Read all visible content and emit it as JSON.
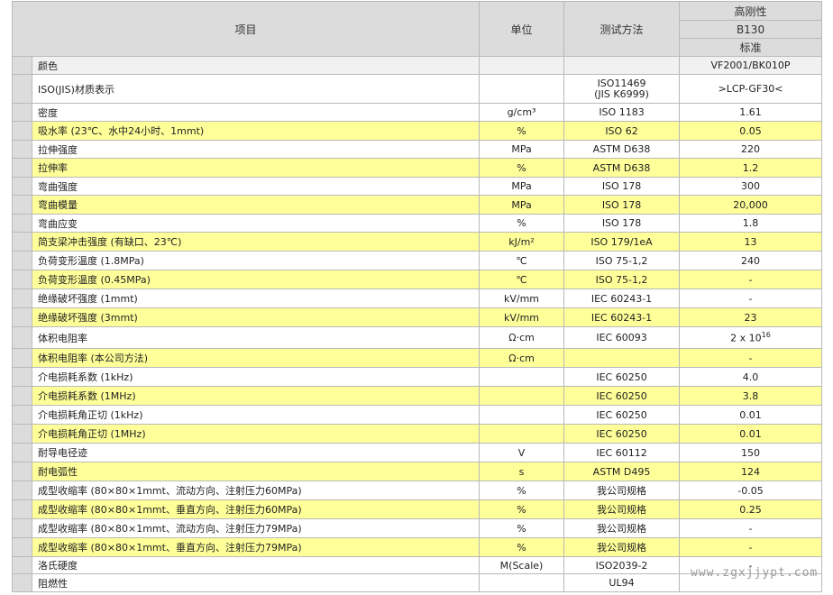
{
  "header": {
    "item": "项目",
    "unit": "单位",
    "method": "测试方法",
    "grade": "高刚性",
    "model": "B130",
    "level": "标准"
  },
  "rows": [
    {
      "name": "颜色",
      "unit": "",
      "method": "",
      "value": "VF2001/BK010P",
      "style": "gray"
    },
    {
      "name": "ISO(JIS)材质表示",
      "unit": "",
      "method": "ISO11469",
      "method2": "(JIS K6999)",
      "value": ">LCP-GF30<",
      "style": "white"
    },
    {
      "name": "密度",
      "unit": "g/cm³",
      "method": "ISO 1183",
      "value": "1.61",
      "style": "white"
    },
    {
      "name": "吸水率 (23℃、水中24小时、1mmt)",
      "unit": "%",
      "method": "ISO 62",
      "value": "0.05",
      "style": "yellow"
    },
    {
      "name": "拉伸强度",
      "unit": "MPa",
      "method": "ASTM D638",
      "value": "220",
      "style": "white"
    },
    {
      "name": "拉伸率",
      "unit": "%",
      "method": "ASTM D638",
      "value": "1.2",
      "style": "yellow"
    },
    {
      "name": "弯曲强度",
      "unit": "MPa",
      "method": "ISO 178",
      "value": "300",
      "style": "white"
    },
    {
      "name": "弯曲模量",
      "unit": "MPa",
      "method": "ISO 178",
      "value": "20,000",
      "style": "yellow"
    },
    {
      "name": "弯曲应变",
      "unit": "%",
      "method": "ISO 178",
      "value": "1.8",
      "style": "white"
    },
    {
      "name": "简支梁冲击强度 (有缺口、23℃)",
      "unit": "kJ/m²",
      "method": "ISO 179/1eA",
      "value": "13",
      "style": "yellow"
    },
    {
      "name": "负荷变形温度 (1.8MPa)",
      "unit": "℃",
      "method": "ISO 75-1,2",
      "value": "240",
      "style": "white"
    },
    {
      "name": "负荷变形温度 (0.45MPa)",
      "unit": "℃",
      "method": "ISO 75-1,2",
      "value": "-",
      "style": "yellow"
    },
    {
      "name": "绝缘破坏强度 (1mmt)",
      "unit": "kV/mm",
      "method": "IEC 60243-1",
      "value": "-",
      "style": "white"
    },
    {
      "name": "绝缘破坏强度 (3mmt)",
      "unit": "kV/mm",
      "method": "IEC 60243-1",
      "value": "23",
      "style": "yellow"
    },
    {
      "name": "体积电阻率",
      "unit": "Ω·cm",
      "method": "IEC 60093",
      "value": "2 x 10",
      "value_sup": "16",
      "style": "white"
    },
    {
      "name": "体积电阻率 (本公司方法)",
      "unit": "Ω·cm",
      "method": "",
      "value": "-",
      "style": "yellow"
    },
    {
      "name": "介电损耗系数 (1kHz)",
      "unit": "",
      "method": "IEC 60250",
      "value": "4.0",
      "style": "white"
    },
    {
      "name": "介电损耗系数 (1MHz)",
      "unit": "",
      "method": "IEC 60250",
      "value": "3.8",
      "style": "yellow"
    },
    {
      "name": "介电损耗角正切 (1kHz)",
      "unit": "",
      "method": "IEC 60250",
      "value": "0.01",
      "style": "white"
    },
    {
      "name": "介电损耗角正切 (1MHz)",
      "unit": "",
      "method": "IEC 60250",
      "value": "0.01",
      "style": "yellow"
    },
    {
      "name": "耐导电径迹",
      "unit": "V",
      "method": "IEC 60112",
      "value": "150",
      "style": "white"
    },
    {
      "name": "耐电弧性",
      "unit": "s",
      "method": "ASTM D495",
      "value": "124",
      "style": "yellow"
    },
    {
      "name": "成型收缩率 (80×80×1mmt、流动方向、注射压力60MPa)",
      "unit": "%",
      "method": "我公司规格",
      "value": "-0.05",
      "style": "white"
    },
    {
      "name": "成型收缩率 (80×80×1mmt、垂直方向、注射压力60MPa)",
      "unit": "%",
      "method": "我公司规格",
      "value": "0.25",
      "style": "yellow"
    },
    {
      "name": "成型收缩率 (80×80×1mmt、流动方向、注射压力79MPa)",
      "unit": "%",
      "method": "我公司规格",
      "value": "-",
      "style": "white"
    },
    {
      "name": "成型收缩率 (80×80×1mmt、垂直方向、注射压力79MPa)",
      "unit": "%",
      "method": "我公司规格",
      "value": "-",
      "style": "yellow"
    },
    {
      "name": "洛氏硬度",
      "unit": "M(Scale)",
      "method": "ISO2039-2",
      "value": "-",
      "style": "white"
    },
    {
      "name": "阻燃性",
      "unit": "",
      "method": "UL94",
      "value": "",
      "style": "white"
    }
  ],
  "watermark": "www.zgxjjypt.com"
}
